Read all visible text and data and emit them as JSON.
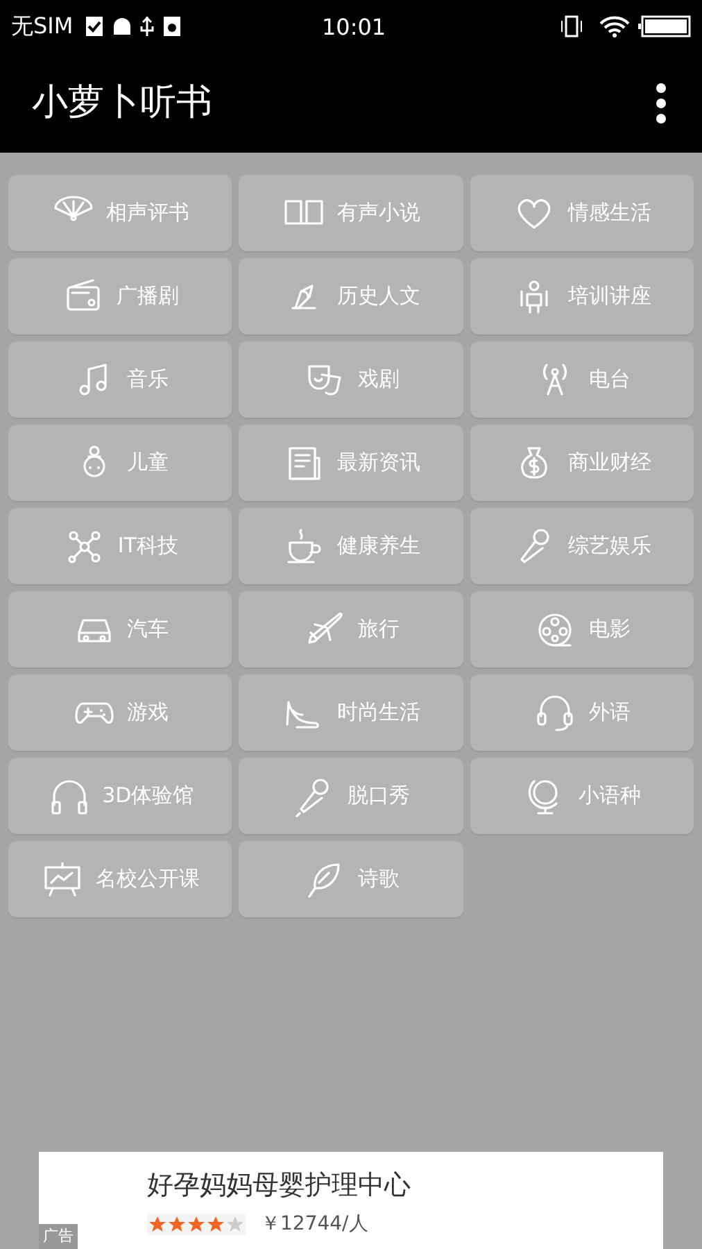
{
  "status_bar": {
    "carrier": "无SIM",
    "time": "10:01"
  },
  "app_bar": {
    "title": "小萝卜听书"
  },
  "categories": [
    {
      "label": "相声评书"
    },
    {
      "label": "有声小说"
    },
    {
      "label": "情感生活"
    },
    {
      "label": "广播剧"
    },
    {
      "label": "历史人文"
    },
    {
      "label": "培训讲座"
    },
    {
      "label": "音乐"
    },
    {
      "label": "戏剧"
    },
    {
      "label": "电台"
    },
    {
      "label": "儿童"
    },
    {
      "label": "最新资讯"
    },
    {
      "label": "商业财经"
    },
    {
      "label": "IT科技"
    },
    {
      "label": "健康养生"
    },
    {
      "label": "综艺娱乐"
    },
    {
      "label": "汽车"
    },
    {
      "label": "旅行"
    },
    {
      "label": "电影"
    },
    {
      "label": "游戏"
    },
    {
      "label": "时尚生活"
    },
    {
      "label": "外语"
    },
    {
      "label": "3D体验馆"
    },
    {
      "label": "脱口秀"
    },
    {
      "label": "小语种"
    },
    {
      "label": "名校公开课"
    },
    {
      "label": "诗歌"
    }
  ],
  "ad": {
    "title": "好孕妈妈母婴护理中心",
    "stars": 4,
    "price": "￥12744/人",
    "badge": "广告"
  }
}
